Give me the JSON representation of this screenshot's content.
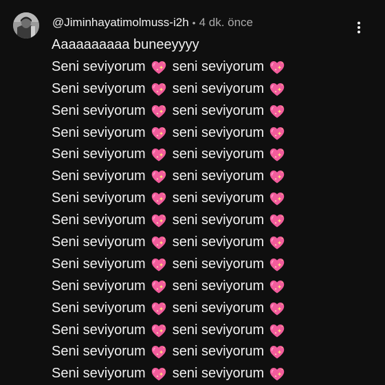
{
  "comment": {
    "author": "@Jiminhayatimolmuss-i2h",
    "separator": "•",
    "time": "4 dk. önce",
    "first_line": "Aaaaaaaaaa buneeyyyy",
    "lines": [
      {
        "a": "Seni seviyorum",
        "b": "seni seviyorum"
      },
      {
        "a": "Seni seviyorum",
        "b": "seni seviyorum"
      },
      {
        "a": "Seni seviyorum",
        "b": "seni seviyorum"
      },
      {
        "a": "Seni seviyorum",
        "b": "seni seviyorum"
      },
      {
        "a": "Seni seviyorum",
        "b": "seni seviyorum"
      },
      {
        "a": "Seni seviyorum",
        "b": "seni seviyorum"
      },
      {
        "a": "Seni seviyorum",
        "b": "seni seviyorum"
      },
      {
        "a": "Seni seviyorum",
        "b": "seni seviyorum"
      },
      {
        "a": "Seni seviyorum",
        "b": "seni seviyorum"
      },
      {
        "a": "Seni seviyorum",
        "b": "seni seviyorum"
      },
      {
        "a": "Seni seviyorum",
        "b": "seni seviyorum"
      },
      {
        "a": "Seni seviyorum",
        "b": "seni seviyorum"
      },
      {
        "a": "Seni seviyorum",
        "b": "seni seviyorum"
      },
      {
        "a": "Seni seviyorum",
        "b": "seni seviyorum"
      },
      {
        "a": "Seni seviyorum",
        "b": "seni seviyorum"
      }
    ],
    "heart_icon": "sparkling-heart-icon",
    "menu_icon": "more-vertical-icon"
  },
  "colors": {
    "background": "#0f0f0f",
    "text": "#f1f1f1",
    "secondary_text": "#aaaaaa",
    "heart": "#f25c9c"
  }
}
